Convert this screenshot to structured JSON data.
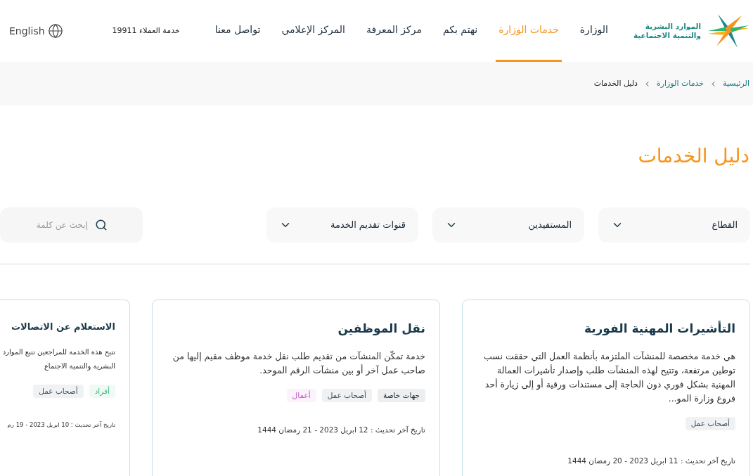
{
  "header": {
    "logo_lines": [
      "الموارد البشرية",
      "والتنمية الاجتماعية"
    ],
    "nav": [
      {
        "label": "الوزارة",
        "selected": false
      },
      {
        "label": "خدمات الوزارة",
        "selected": true
      },
      {
        "label": "نهتم بكم",
        "selected": false
      },
      {
        "label": "مركز المعرفة",
        "selected": false
      },
      {
        "label": "المركز الإعلامي",
        "selected": false
      },
      {
        "label": "تواصل معنا",
        "selected": false
      }
    ],
    "customer_service": "خدمة العملاء 19911",
    "language": "English"
  },
  "breadcrumb": [
    "الرئيسية",
    "خدمات الوزارة",
    "دليل الخدمات"
  ],
  "page_title": "دليل الخدمات",
  "filters": [
    "القطاع",
    "المستفيدين",
    "قنوات تقديم الخدمة"
  ],
  "search": {
    "placeholder": "إبحث عن كلمة"
  },
  "cards": [
    {
      "title": "التأشيرات المهنية الفورية",
      "description": "هي خدمة مخصصة للمنشآت الملتزمة بأنظمة العمل التي حققت نسب توطين مرتفعة، وتتيح لهذه المنشآت طلب وإصدار تأشيرات العمالة المهنية بشكل فوري دون الحاجة إلى مستندات ورقية أو إلى زيارة أحد فروع وزارة المو...",
      "tags": [
        {
          "label": "أصحاب عمل",
          "color": "#3b5160"
        }
      ],
      "updated": "تاريخ آخر تحديث : 11 ابريل 2023 - 20 رمضان 1444"
    },
    {
      "title": "نقل الموظفين",
      "description": "خدمة تمكّن المنشآت من تقديم طلب نقل خدمة موظف مقيم إليها من صاحب عمل آخر أو بين منشآت الرقم الموحد.",
      "tags": [
        {
          "label": "جهات خاصة",
          "color": "#1f2937"
        },
        {
          "label": "أصحاب عمل",
          "color": "#3b5160"
        },
        {
          "label": "أعمال",
          "color": "#c957c9"
        }
      ],
      "updated": "تاريخ آخر تحديث : 12 ابريل 2023 - 21 رمضان 1444"
    },
    {
      "title": "الاستعلام عن الاتصالات",
      "description": "تتيح هذه الخدمة للمراجعين تتبع الموارد البشرية والتنمية الاجتماع",
      "tags": [
        {
          "label": "أفراد",
          "color": "#3fb97a"
        },
        {
          "label": "أصحاب عمل",
          "color": "#3b5160"
        }
      ],
      "updated": "تاريخ آخر تحديث : 10 ابريل 2023 - 19 رم"
    }
  ]
}
